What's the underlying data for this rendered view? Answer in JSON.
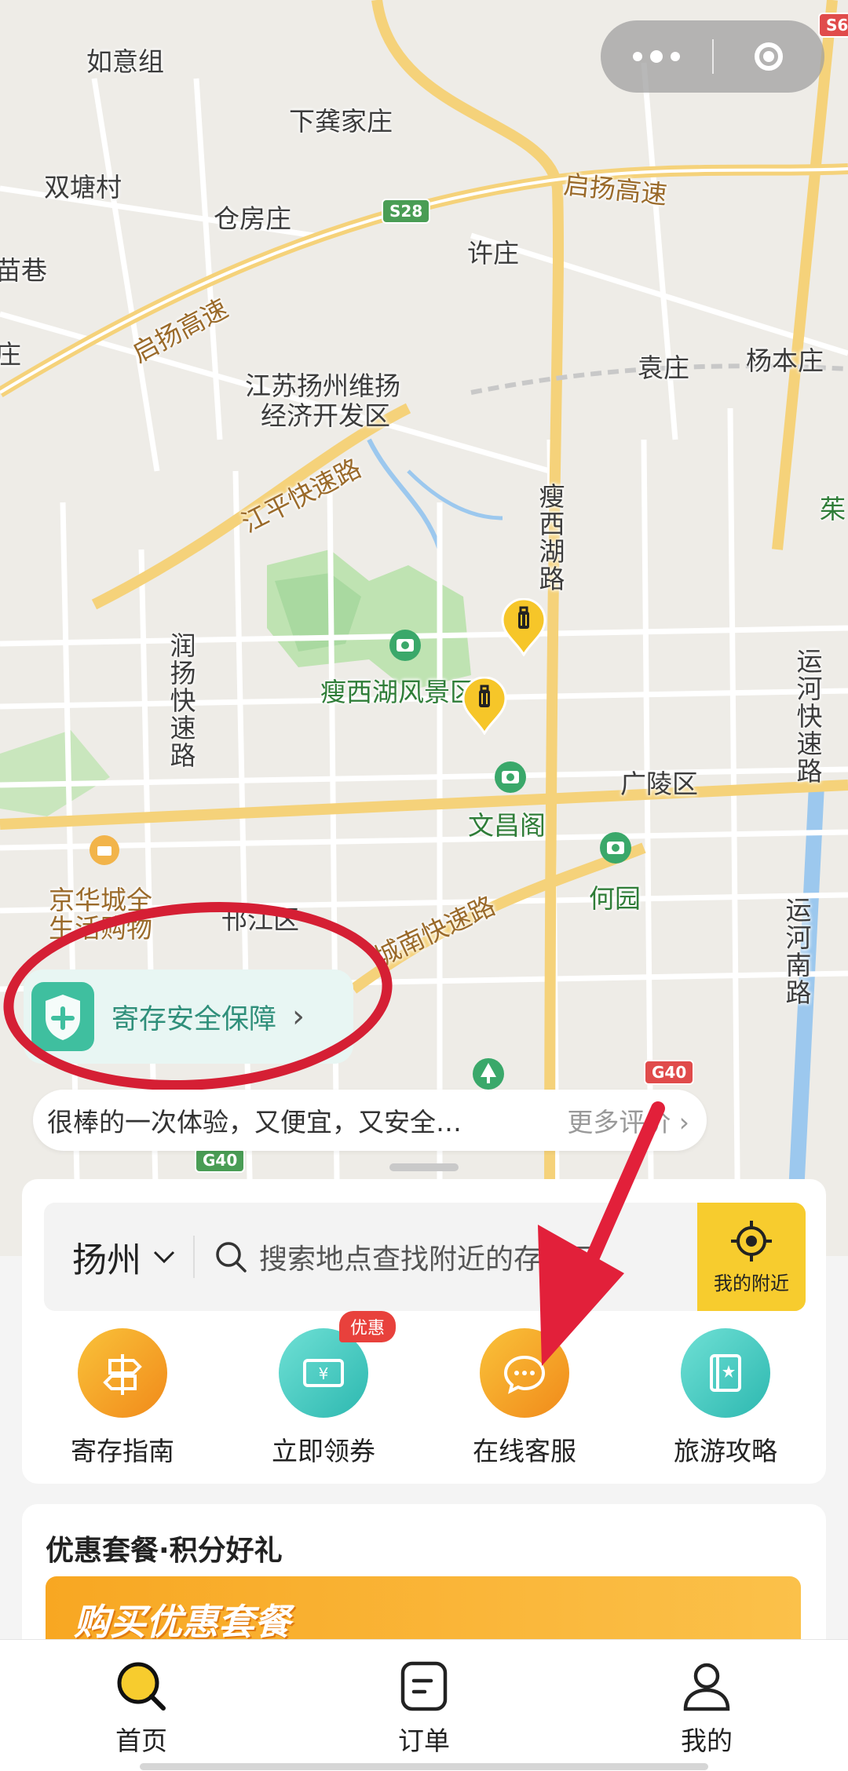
{
  "map": {
    "labels": [
      {
        "text": "如意组",
        "cls": ""
      },
      {
        "text": "下龚家庄",
        "cls": ""
      },
      {
        "text": "双塘村",
        "cls": ""
      },
      {
        "text": "仓房庄",
        "cls": ""
      },
      {
        "text": "启扬高速",
        "cls": "brown"
      },
      {
        "text": "许庄",
        "cls": ""
      },
      {
        "text": "启扬高速",
        "cls": "brown"
      },
      {
        "text": "袁庄",
        "cls": ""
      },
      {
        "text": "杨本庄",
        "cls": ""
      },
      {
        "text": "江苏扬州维扬",
        "cls": ""
      },
      {
        "text": "经济开发区",
        "cls": ""
      },
      {
        "text": "江平快速路",
        "cls": "brown"
      },
      {
        "text": "瘦西湖路",
        "cls": "vert"
      },
      {
        "text": "润扬快速路",
        "cls": "vert"
      },
      {
        "text": "运河快速路",
        "cls": "vert"
      },
      {
        "text": "瘦西湖风景区",
        "cls": "green"
      },
      {
        "text": "广陵区",
        "cls": ""
      },
      {
        "text": "文昌阁",
        "cls": "green"
      },
      {
        "text": "何园",
        "cls": "green"
      },
      {
        "text": "京华城全",
        "cls": "brown"
      },
      {
        "text": "生活购物",
        "cls": "brown"
      },
      {
        "text": "邗江区",
        "cls": ""
      },
      {
        "text": "城南快速路",
        "cls": "brown"
      },
      {
        "text": "运河南路",
        "cls": "vert"
      },
      {
        "text": "苗巷",
        "cls": ""
      },
      {
        "text": "庄",
        "cls": ""
      },
      {
        "text": "茱",
        "cls": "green"
      }
    ],
    "shields": [
      "S28",
      "G40",
      "G40",
      "S6"
    ]
  },
  "capsule": {
    "more_icon": "more-dots-icon",
    "close_icon": "target-close-icon"
  },
  "safety": {
    "label": "寄存安全保障",
    "chevron": "›"
  },
  "review": {
    "text": "很棒的一次体验，又便宜，又安全…",
    "more": "更多评价 ›"
  },
  "search": {
    "city": "扬州",
    "placeholder": "搜索地点查找附近的存知己",
    "nearby_label": "我的附近"
  },
  "actions": [
    {
      "label": "寄存指南",
      "icon": "signpost-icon",
      "badge": ""
    },
    {
      "label": "立即领券",
      "icon": "coupon-icon",
      "badge": "优惠"
    },
    {
      "label": "在线客服",
      "icon": "chat-icon",
      "badge": ""
    },
    {
      "label": "旅游攻略",
      "icon": "guidebook-icon",
      "badge": ""
    }
  ],
  "promo": {
    "title": "优惠套餐·积分好礼",
    "banner_text": "购买优惠套餐"
  },
  "tabs": [
    {
      "label": "首页",
      "icon": "search-icon"
    },
    {
      "label": "订单",
      "icon": "order-icon"
    },
    {
      "label": "我的",
      "icon": "profile-icon"
    }
  ],
  "colors": {
    "brand_yellow": "#f7cc2e",
    "annotation_red": "#d51f34",
    "teal": "#2db8b0",
    "orange": "#f18a1a"
  }
}
